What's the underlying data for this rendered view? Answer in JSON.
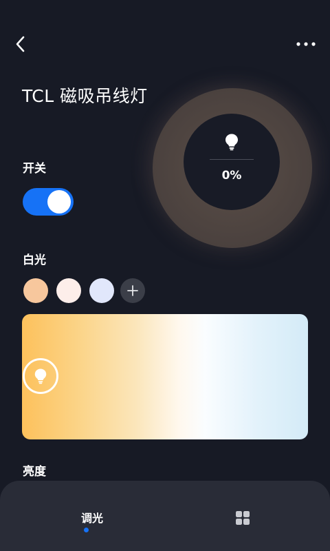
{
  "header": {
    "back_icon": "chevron-left-icon",
    "more_icon": "more-dots-icon",
    "title": "TCL 磁吸吊线灯"
  },
  "ring": {
    "icon": "lightbulb-icon",
    "value": "0%"
  },
  "power": {
    "label": "开关",
    "on": true,
    "accent": "#1672f6"
  },
  "white_light": {
    "label": "白光",
    "presets": [
      "#f7c79d",
      "#fdeeea",
      "#e1e7fb"
    ],
    "add_icon": "plus-icon",
    "gradient_colors": [
      "#fdc15c",
      "#fff8ee",
      "#d4ebf7"
    ],
    "picker_icon": "lightbulb-icon"
  },
  "brightness": {
    "label": "亮度"
  },
  "bottom_nav": {
    "tabs": [
      {
        "label": "调光",
        "active": true
      },
      {
        "label": "",
        "icon": "grid-icon",
        "active": false
      }
    ]
  }
}
